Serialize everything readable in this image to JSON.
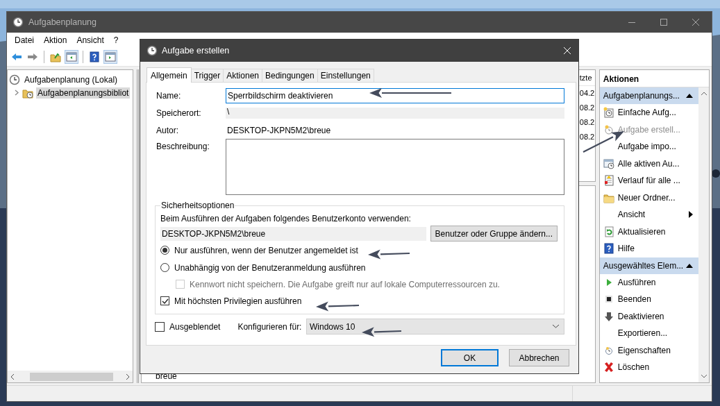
{
  "main_window": {
    "title": "Aufgabenplanung",
    "menu": [
      "Datei",
      "Aktion",
      "Ansicht",
      "?"
    ],
    "tree": [
      {
        "label": "Aufgabenplanung (Lokal)",
        "selected": false,
        "children": [
          {
            "label": "Aufgabenplanungsbibliot",
            "selected": true,
            "expanded": false
          }
        ]
      }
    ],
    "list": {
      "column_header": "tzte",
      "cells": [
        "04.2",
        "08.2",
        "08.2",
        "08.2"
      ],
      "detail_text": "breue"
    },
    "actions": {
      "title": "Aktionen",
      "sections": [
        {
          "title": "Aufgabenplanungs...",
          "expanded": true,
          "items": [
            {
              "kind": "wizard",
              "label": "Einfache Aufg...",
              "disabled": false
            },
            {
              "kind": "create",
              "label": "Aufgabe erstell...",
              "disabled": true
            },
            {
              "kind": "import",
              "label": "Aufgabe impo...",
              "disabled": false
            },
            {
              "kind": "running",
              "label": "Alle aktiven Au...",
              "disabled": false
            },
            {
              "kind": "history",
              "label": "Verlauf für alle ...",
              "disabled": false
            },
            {
              "kind": "folder",
              "label": "Neuer Ordner...",
              "disabled": false
            },
            {
              "kind": "submenu",
              "label": "Ansicht",
              "disabled": false
            },
            {
              "kind": "refresh",
              "label": "Aktualisieren",
              "disabled": false
            },
            {
              "kind": "help",
              "label": "Hilfe",
              "disabled": false
            }
          ]
        },
        {
          "title": "Ausgewähltes Elem...",
          "expanded": true,
          "items": [
            {
              "kind": "run",
              "label": "Ausführen",
              "disabled": false
            },
            {
              "kind": "stop",
              "label": "Beenden",
              "disabled": false
            },
            {
              "kind": "disable",
              "label": "Deaktivieren",
              "disabled": false
            },
            {
              "kind": "export",
              "label": "Exportieren...",
              "disabled": false
            },
            {
              "kind": "properties",
              "label": "Eigenschaften",
              "disabled": false
            },
            {
              "kind": "delete",
              "label": "Löschen",
              "disabled": false
            }
          ]
        }
      ]
    }
  },
  "dialog": {
    "title": "Aufgabe erstellen",
    "tabs": [
      {
        "label": "Allgemein",
        "selected": true
      },
      {
        "label": "Trigger",
        "selected": false
      },
      {
        "label": "Aktionen",
        "selected": false
      },
      {
        "label": "Bedingungen",
        "selected": false
      },
      {
        "label": "Einstellungen",
        "selected": false
      }
    ],
    "name": {
      "label": "Name:",
      "value": "Sperrbildschirm deaktivieren"
    },
    "location": {
      "label": "Speicherort:",
      "value": "\\"
    },
    "author": {
      "label": "Autor:",
      "value": "DESKTOP-JKPN5M2\\breue"
    },
    "description": {
      "label": "Beschreibung:"
    },
    "security": {
      "title": "Sicherheitsoptionen",
      "account_prompt": "Beim Ausführen der Aufgaben folgendes Benutzerkonto verwenden:",
      "account": "DESKTOP-JKPN5M2\\breue",
      "change_button": "Benutzer oder Gruppe ändern...",
      "options": [
        {
          "kind": "radio",
          "label": "Nur ausführen, wenn der Benutzer angemeldet ist",
          "selected": true,
          "disabled": false
        },
        {
          "kind": "radio",
          "label": "Unabhängig von der Benutzeranmeldung ausführen",
          "selected": false,
          "disabled": false,
          "children": [
            {
              "kind": "checkbox",
              "label": "Kennwort nicht speichern. Die Aufgabe greift nur auf lokale Computerressourcen zu.",
              "checked": false,
              "disabled": true
            }
          ]
        },
        {
          "kind": "checkbox",
          "label": "Mit höchsten Privilegien ausführen",
          "checked": true,
          "disabled": false
        }
      ]
    },
    "hidden": {
      "label": "Ausgeblendet",
      "checked": false
    },
    "configure": {
      "label": "Konfigurieren für:",
      "value": "Windows 10"
    },
    "buttons": [
      {
        "label": "OK",
        "default": true
      },
      {
        "label": "Abbrechen",
        "default": false
      }
    ]
  }
}
